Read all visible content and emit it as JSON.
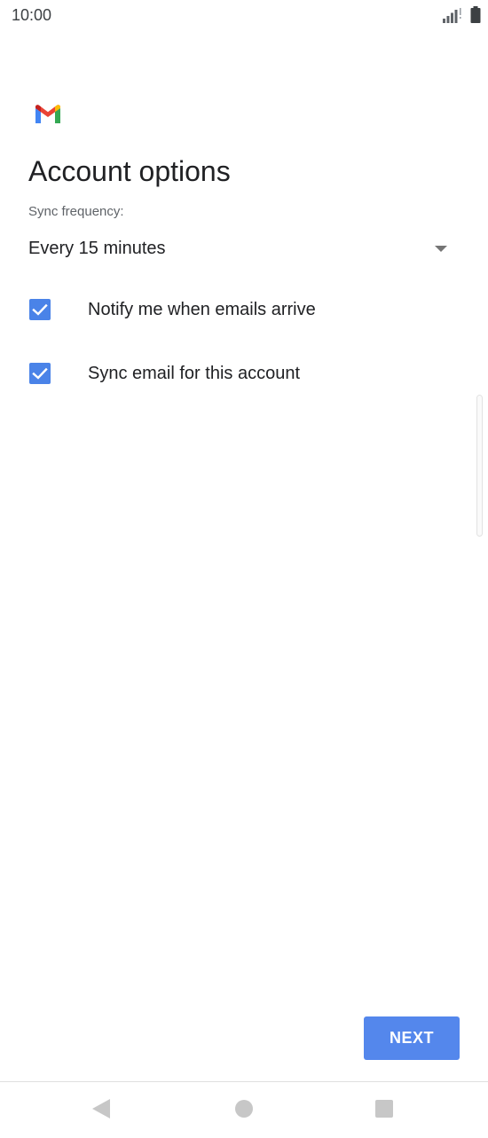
{
  "status_bar": {
    "time": "10:00",
    "signal_icon": "signal-icon",
    "battery_icon": "battery-icon"
  },
  "logo": {
    "icon": "gmail-logo",
    "colors": [
      "#4285f4",
      "#ea4335",
      "#fbbc04",
      "#34a853",
      "#c5221f"
    ]
  },
  "title": "Account options",
  "sync": {
    "label": "Sync frequency:",
    "selected": "Every 15 minutes",
    "arrow_icon": "dropdown-arrow-icon"
  },
  "options": [
    {
      "label": "Notify me when emails arrive",
      "checked": true
    },
    {
      "label": "Sync email for this account",
      "checked": true
    }
  ],
  "next_button": {
    "label": "NEXT",
    "color": "#5487ec"
  },
  "nav_bar": {
    "back_icon": "back-icon",
    "home_icon": "home-icon",
    "recents_icon": "recents-icon"
  },
  "colors": {
    "checkbox": "#4a83e8",
    "text": "#202124",
    "secondary_text": "#5f6368"
  }
}
